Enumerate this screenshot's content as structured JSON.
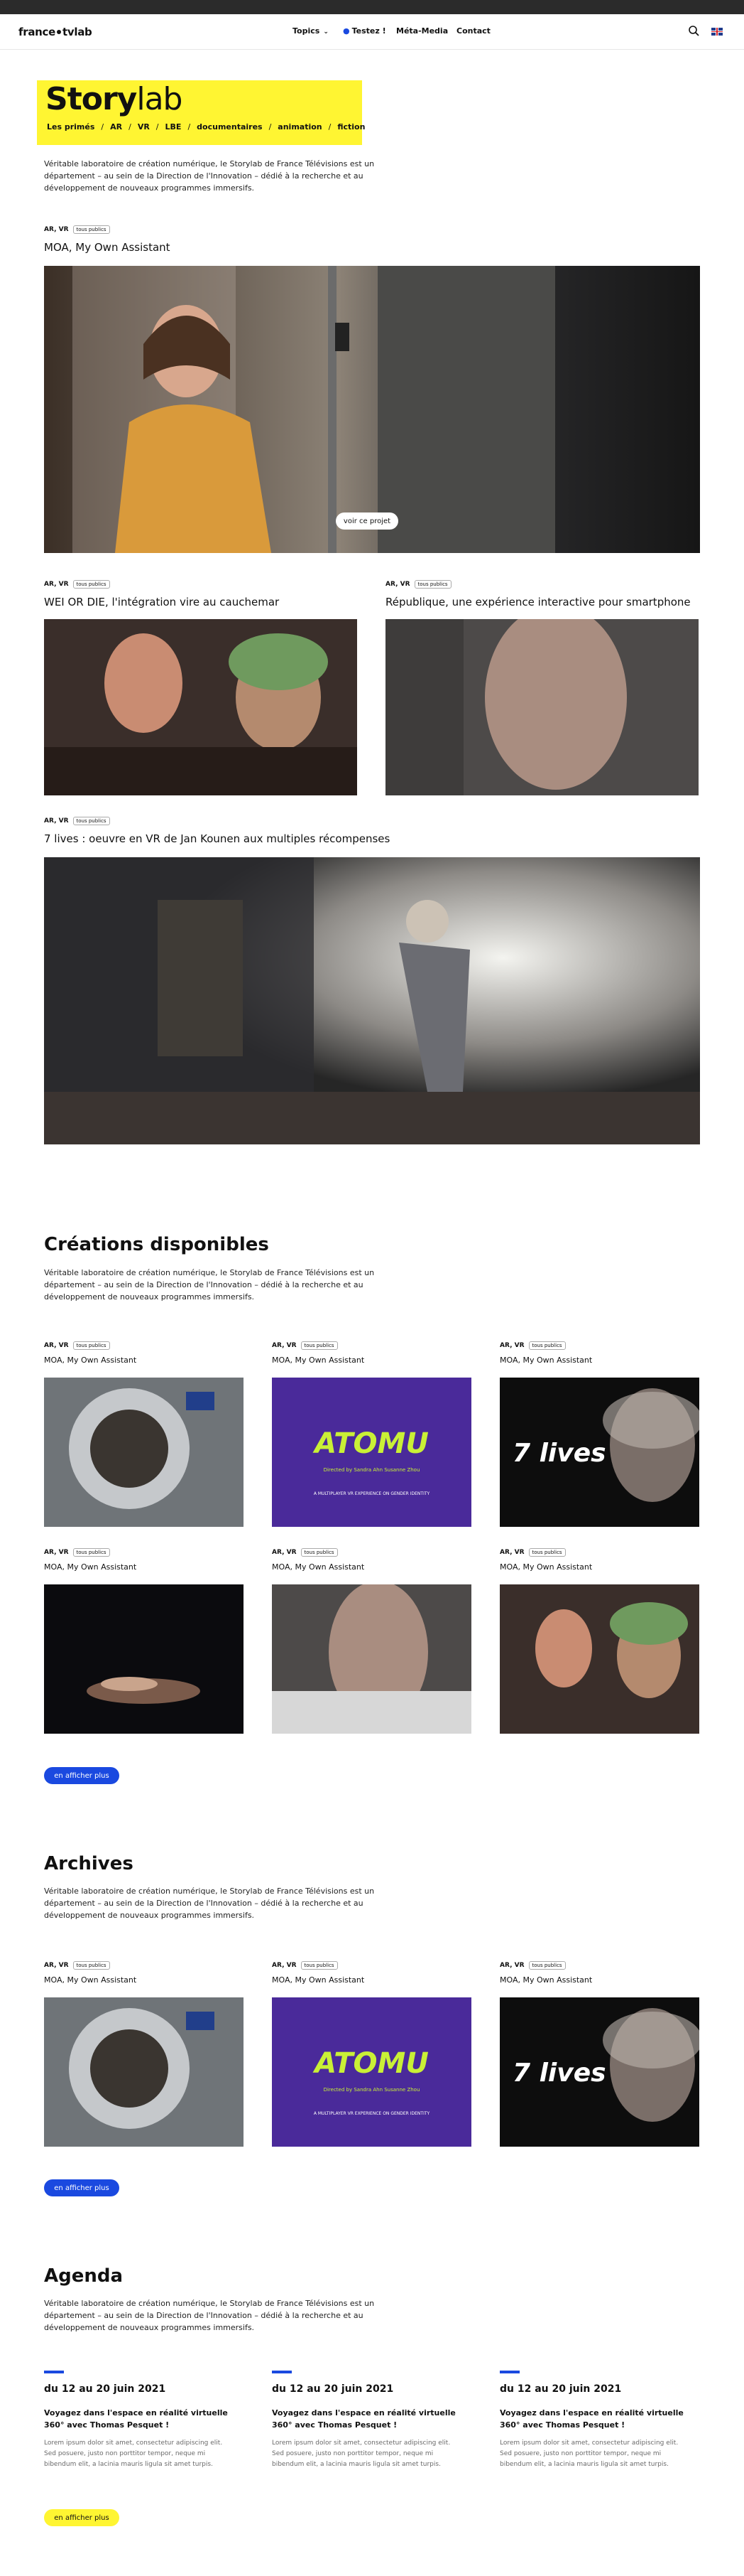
{
  "header": {
    "logo_left": "france",
    "logo_right": "tvlab",
    "nav": {
      "topics": "Topics",
      "testez": "Testez !",
      "meta": "Méta-Media",
      "contact": "Contact"
    }
  },
  "hero": {
    "title_bold": "Story",
    "title_light": "lab",
    "tags": [
      "Les primés",
      "AR",
      "VR",
      "LBE",
      "documentaires",
      "animation",
      "fiction"
    ],
    "description": "Véritable laboratoire de création numérique, le Storylab de France Télévisions est un département – au sein de la Direction de l'Innovation – dédié à la recherche et au développement de nouveaux programmes immersifs."
  },
  "featured": {
    "main": {
      "tags": "AR, VR",
      "badge": "tous publics",
      "title": "MOA, My Own Assistant",
      "cta": "voir ce projet"
    },
    "left": {
      "tags": "AR, VR",
      "badge": "tous publics",
      "title": "WEI OR DIE, l'intégration vire au cauchemar"
    },
    "right": {
      "tags": "AR, VR",
      "badge": "tous publics",
      "title": "République, une expérience interactive pour smartphone"
    },
    "wide": {
      "tags": "AR, VR",
      "badge": "tous publics",
      "title": "7 lives : oeuvre en VR de Jan Kounen aux multiples récompenses"
    }
  },
  "creations": {
    "title": "Créations disponibles",
    "description": "Véritable laboratoire de création numérique, le Storylab de France Télévisions est un département – au sein de la Direction de l'Innovation – dédié à la recherche et au développement de nouveaux programmes immersifs.",
    "items": [
      {
        "tags": "AR, VR",
        "badge": "tous publics",
        "title": "MOA, My Own Assistant"
      },
      {
        "tags": "AR, VR",
        "badge": "tous publics",
        "title": "MOA, My Own Assistant"
      },
      {
        "tags": "AR, VR",
        "badge": "tous publics",
        "title": "MOA, My Own Assistant"
      },
      {
        "tags": "AR, VR",
        "badge": "tous publics",
        "title": "MOA, My Own Assistant"
      },
      {
        "tags": "AR, VR",
        "badge": "tous publics",
        "title": "MOA, My Own Assistant"
      },
      {
        "tags": "AR, VR",
        "badge": "tous publics",
        "title": "MOA, My Own Assistant"
      }
    ],
    "more": "en afficher plus"
  },
  "archives": {
    "title": "Archives",
    "description": "Véritable laboratoire de création numérique, le Storylab de France Télévisions est un département – au sein de la Direction de l'Innovation – dédié à la recherche et au développement de nouveaux programmes immersifs.",
    "items": [
      {
        "tags": "AR, VR",
        "badge": "tous publics",
        "title": "MOA, My Own Assistant"
      },
      {
        "tags": "AR, VR",
        "badge": "tous publics",
        "title": "MOA, My Own Assistant"
      },
      {
        "tags": "AR, VR",
        "badge": "tous publics",
        "title": "MOA, My Own Assistant"
      }
    ],
    "more": "en afficher plus"
  },
  "poster_text": {
    "atomu": "ATOMU",
    "atomu_sub": "A MULTIPLAYER VR EXPERIENCE ON GENDER IDENTITY",
    "atomu_credit": "Directed by Sandra Ahn Susanne Zhou",
    "sevenlives": "7 lives"
  },
  "agenda": {
    "title": "Agenda",
    "description": "Véritable laboratoire de création numérique, le Storylab de France Télévisions est un département – au sein de la Direction de l'Innovation – dédié à la recherche et au développement de nouveaux programmes immersifs.",
    "items": [
      {
        "date": "du 12 au 20 juin 2021",
        "title": "Voyagez dans l'espace en réalité virtuelle 360° avec Thomas Pesquet !",
        "text": "Lorem ipsum dolor sit amet, consectetur adipiscing elit. Sed posuere, justo non porttitor tempor, neque mi bibendum elit, a lacinia mauris ligula sit amet turpis."
      },
      {
        "date": "du 12 au 20 juin 2021",
        "title": "Voyagez dans l'espace en réalité virtuelle 360° avec Thomas Pesquet !",
        "text": "Lorem ipsum dolor sit amet, consectetur adipiscing elit. Sed posuere, justo non porttitor tempor, neque mi bibendum elit, a lacinia mauris ligula sit amet turpis."
      },
      {
        "date": "du 12 au 20 juin 2021",
        "title": "Voyagez dans l'espace en réalité virtuelle 360° avec Thomas Pesquet !",
        "text": "Lorem ipsum dolor sit amet, consectetur adipiscing elit. Sed posuere, justo non porttitor tempor, neque mi bibendum elit, a lacinia mauris ligula sit amet turpis."
      }
    ],
    "more": "en afficher plus"
  },
  "icons": {
    "search": "search-icon",
    "flag": "uk-flag-icon",
    "pin": "pin-icon",
    "chevron": "chevron-down-icon"
  },
  "colors": {
    "accent_yellow": "#fff532",
    "accent_blue": "#1a49e0"
  }
}
